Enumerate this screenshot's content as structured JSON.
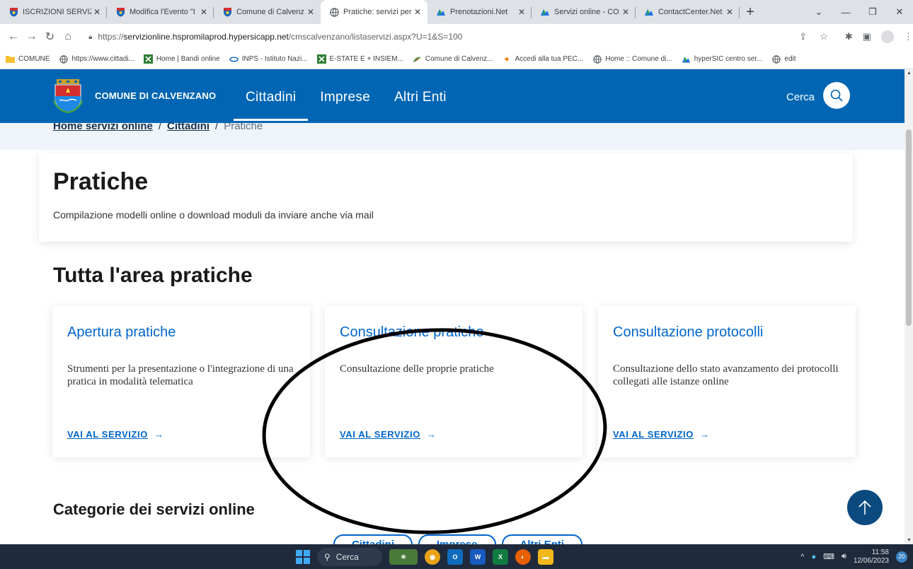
{
  "browser": {
    "tabs": [
      {
        "title": "ISCRIZIONI SERVIZI",
        "favicon": "comune-crest-icon"
      },
      {
        "title": "Modifica l'Evento \"I",
        "favicon": "comune-crest-icon"
      },
      {
        "title": "Comune di Calvenz",
        "favicon": "comune-crest-icon"
      },
      {
        "title": "Pratiche: servizi per",
        "favicon": "globe-icon",
        "active": true
      },
      {
        "title": "Prenotazioni.Net",
        "favicon": "hypersic-icon"
      },
      {
        "title": "Servizi online - CO",
        "favicon": "hypersic-icon"
      },
      {
        "title": "ContactCenter.Net",
        "favicon": "hypersic-icon"
      }
    ],
    "url_prefix": "https://",
    "url_host": "servizionline.hspromilaprod.hypersicapp.net",
    "url_path": "/cmscalvenzano/listaservizi.aspx?U=1&S=100",
    "bookmarks": [
      {
        "label": "COMUNE",
        "icon": "folder-icon"
      },
      {
        "label": "https://www.cittadi...",
        "icon": "globe-icon"
      },
      {
        "label": "Home | Bandi online",
        "icon": "green-square-icon"
      },
      {
        "label": "INPS - Istituto Nazi...",
        "icon": "inps-icon"
      },
      {
        "label": "E-STATE E + INSIEM...",
        "icon": "green-square-icon"
      },
      {
        "label": "Comune di Calvenz...",
        "icon": "leaf-icon"
      },
      {
        "label": "Accedi alla tua PEC...",
        "icon": "star-burst-icon"
      },
      {
        "label": "Home :: Comune di...",
        "icon": "globe-icon"
      },
      {
        "label": "hyperSIC centro ser...",
        "icon": "hypersic-icon"
      },
      {
        "label": "edit",
        "icon": "globe-icon"
      }
    ]
  },
  "site": {
    "name": "COMUNE DI CALVENZANO",
    "nav": [
      {
        "label": "Cittadini",
        "active": true
      },
      {
        "label": "Imprese"
      },
      {
        "label": "Altri Enti"
      }
    ],
    "search_label": "Cerca",
    "brand_color": "#0066b3"
  },
  "breadcrumb": {
    "items": [
      "Home servizi online",
      "Cittadini"
    ],
    "current": "Pratiche",
    "separator": "/"
  },
  "intro": {
    "title": "Pratiche",
    "subtitle": "Compilazione modelli online o download moduli da inviare anche via mail"
  },
  "section": {
    "title": "Tutta l'area pratiche",
    "cards": [
      {
        "title": "Apertura pratiche",
        "description": "Strumenti per la presentazione o l'integrazione di una pratica in modalità telematica",
        "cta": "VAI AL SERVIZIO"
      },
      {
        "title": "Consultazione pratiche",
        "description": "Consultazione delle proprie pratiche",
        "cta": "VAI AL SERVIZIO"
      },
      {
        "title": "Consultazione protocolli",
        "description": "Consultazione dello stato avanzamento dei protocolli collegati alle istanze online",
        "cta": "VAI AL SERVIZIO"
      }
    ]
  },
  "categories": {
    "title": "Categorie dei servizi online",
    "pills": [
      "Cittadini",
      "Imprese",
      "Altri Enti"
    ]
  },
  "taskbar": {
    "search_label": "Cerca",
    "time": "11:58",
    "date": "12/06/2023",
    "notifications": "20"
  }
}
